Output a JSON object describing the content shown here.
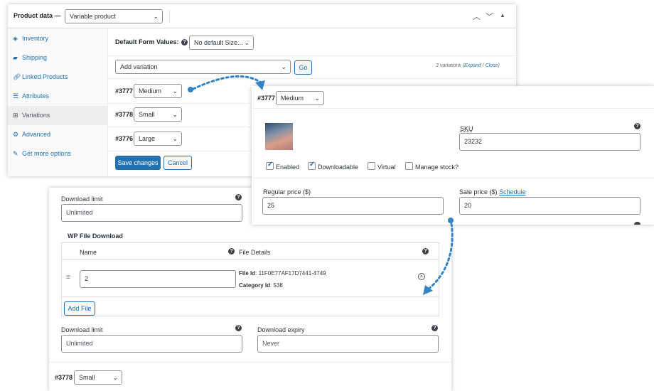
{
  "header": {
    "title": "Product data —",
    "product_type": "Variable product"
  },
  "sidebar": {
    "items": [
      {
        "label": "Inventory",
        "icon": "inventory-icon"
      },
      {
        "label": "Shipping",
        "icon": "truck-icon"
      },
      {
        "label": "Linked Products",
        "icon": "link-icon"
      },
      {
        "label": "Attributes",
        "icon": "list-icon"
      },
      {
        "label": "Variations",
        "icon": "grid-icon"
      },
      {
        "label": "Advanced",
        "icon": "gear-icon"
      },
      {
        "label": "Get more options",
        "icon": "plugin-icon"
      }
    ]
  },
  "variations": {
    "default_label": "Default Form Values:",
    "default_value": "No default Size...",
    "add_variation": "Add variation",
    "go": "Go",
    "count_text": "3 variations (",
    "expand": "Expand",
    "separator": " / ",
    "close": "Close",
    "count_end": ")",
    "rows": [
      {
        "id": "#3777",
        "size": "Medium"
      },
      {
        "id": "#3778",
        "size": "Small"
      },
      {
        "id": "#3776",
        "size": "Large"
      }
    ],
    "save": "Save changes",
    "cancel": "Cancel"
  },
  "detail": {
    "id": "#3777",
    "size": "Medium",
    "sku_label": "SKU",
    "sku_value": "23232",
    "enabled": "Enabled",
    "downloadable": "Downloadable",
    "virtual": "Virtual",
    "manage_stock": "Manage stock?",
    "regular_price_label": "Regular price ($)",
    "regular_price": "25",
    "sale_price_label": "Sale price ($)",
    "schedule": "Schedule",
    "sale_price": "20"
  },
  "download": {
    "limit_label": "Download limit",
    "limit_placeholder": "Unlimited",
    "wpfd_title": "WP File Download",
    "col_name": "Name",
    "col_details": "File Details",
    "file_name": "2",
    "file_id_label": "File Id",
    "file_id": ": 11F0E77AF17D7441-4749",
    "category_label": "Category Id",
    "category_id": ": 538",
    "add_file": "Add File",
    "limit_label2": "Download limit",
    "limit_placeholder2": "Unlimited",
    "expiry_label": "Download expiry",
    "expiry_placeholder": "Never",
    "next_id": "#3778",
    "next_size": "Small"
  },
  "colors": {
    "accent": "#2271b1",
    "arrow": "#3582c4"
  }
}
